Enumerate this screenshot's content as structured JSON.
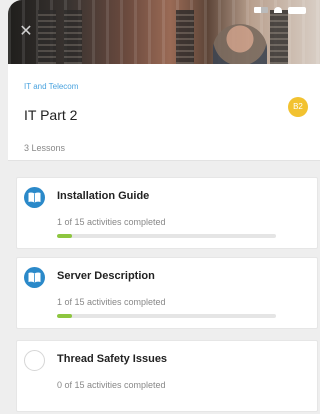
{
  "course": {
    "category": "IT and Telecom",
    "title": "IT Part 2",
    "level": "B2",
    "lesson_count": "3 Lessons"
  },
  "lessons": [
    {
      "name": "Installation Guide",
      "progress_text": "1 of 15 activities completed",
      "progress": 0.0667,
      "status": "started",
      "icon": "book-icon"
    },
    {
      "name": "Server Description",
      "progress_text": "1 of 15 activities completed",
      "progress": 0.0667,
      "status": "started",
      "icon": "book-icon"
    },
    {
      "name": "Thread Safety Issues",
      "progress_text": "0 of 15 activities completed",
      "progress": 0,
      "status": "not-started",
      "icon": "empty-circle-icon"
    }
  ],
  "colors": {
    "accent_blue": "#2b89c9",
    "category_blue": "#4aa3df",
    "level_badge": "#f2c230",
    "progress_green": "#8dc63f"
  }
}
